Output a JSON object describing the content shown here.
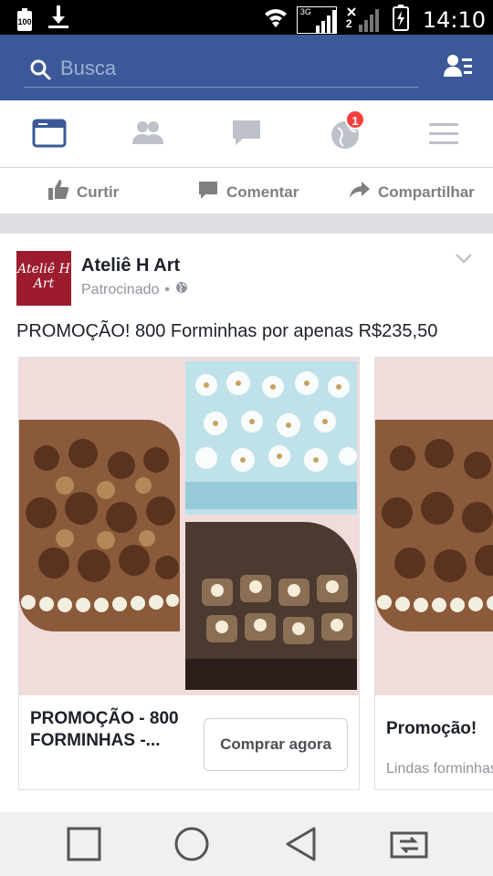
{
  "status_bar": {
    "battery_level_label": "100",
    "network_label": "3G",
    "sim2_label": "2",
    "time": "14:10"
  },
  "search": {
    "placeholder": "Busca"
  },
  "nav": {
    "notification_badge": "1"
  },
  "actions": {
    "like": "Curtir",
    "comment": "Comentar",
    "share": "Compartilhar"
  },
  "post": {
    "page_name": "Ateliê H Art",
    "sponsored": "Patrocinado",
    "sponsored_sep": "•",
    "avatar_text": "Ateliê H Art",
    "text": "PROMOÇÃO! 800 Forminhas por apenas R$235,50"
  },
  "carousel": [
    {
      "title": "PROMOÇÃO - 800 FORMINHAS -...",
      "button": "Comprar agora"
    },
    {
      "title": "Promoção!",
      "subtitle": "Lindas forminhas"
    }
  ],
  "colors": {
    "brand": "#3b5998",
    "badge": "#fa3e3e"
  }
}
